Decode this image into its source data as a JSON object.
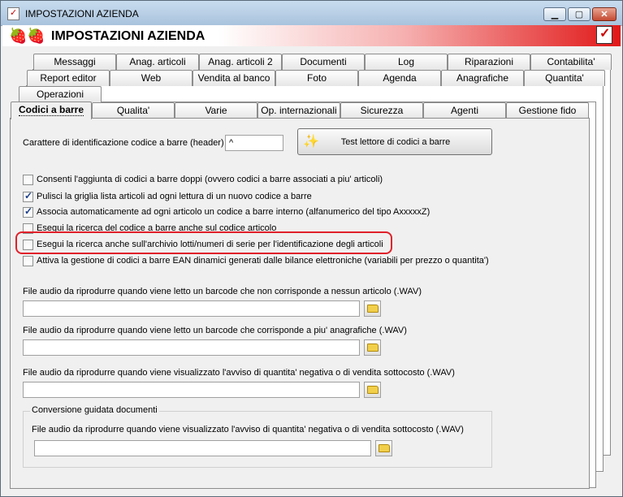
{
  "window": {
    "title": "IMPOSTAZIONI AZIENDA"
  },
  "banner": {
    "heading": "IMPOSTAZIONI AZIENDA",
    "logo": "🍓🍓"
  },
  "tabs": {
    "row1": [
      "Messaggi",
      "Anag. articoli",
      "Anag. articoli 2",
      "Documenti",
      "Log",
      "Riparazioni",
      "Contabilita'"
    ],
    "row2": [
      "Report editor",
      "Web",
      "Vendita al banco",
      "Foto",
      "Agenda",
      "Anagrafiche",
      "Quantita'"
    ],
    "row3": [
      "Operazioni"
    ],
    "row4": [
      "Codici a barre",
      "Qualita'",
      "Varie",
      "Op. internazionali",
      "Sicurezza",
      "Agenti",
      "Gestione fido"
    ]
  },
  "barcode": {
    "header_label": "Carattere di identificazione codice a barre (header) :",
    "header_value": "^",
    "test_button": "Test lettore di codici a barre"
  },
  "checkboxes": [
    {
      "label": "Consenti l'aggiunta di codici a barre doppi (ovvero codici a barre associati a piu' articoli)",
      "checked": false
    },
    {
      "label": "Pulisci la griglia lista articoli ad ogni lettura di un nuovo codice a barre",
      "checked": true
    },
    {
      "label": "Associa automaticamente ad ogni articolo un codice a barre interno (alfanumerico del tipo AxxxxxZ)",
      "checked": true
    },
    {
      "label": "Esegui la ricerca del codice a barre anche sul codice articolo",
      "checked": false
    },
    {
      "label": "Esegui la ricerca anche sull'archivio lotti/numeri di serie per l'identificazione degli articoli",
      "checked": false
    },
    {
      "label": "Attiva la gestione di codici a barre EAN dinamici generati dalle bilance elettroniche (variabili per prezzo o quantita')",
      "checked": false
    }
  ],
  "audio": {
    "no_match_label": "File audio da riprodurre quando viene letto un barcode che non corrisponde a nessun articolo (.WAV)",
    "no_match_value": "",
    "multi_match_label": "File audio da riprodurre quando viene letto un barcode che corrisponde a piu' anagrafiche (.WAV)",
    "multi_match_value": "",
    "negative_qty_label": "File audio da riprodurre quando viene visualizzato l'avviso di quantita' negativa o di vendita sottocosto (.WAV)",
    "negative_qty_value": ""
  },
  "guided_conversion": {
    "group_title": "Conversione guidata documenti",
    "label": "File audio da riprodurre quando viene visualizzato l'avviso di quantita' negativa o di vendita sottocosto (.WAV)",
    "value": ""
  }
}
